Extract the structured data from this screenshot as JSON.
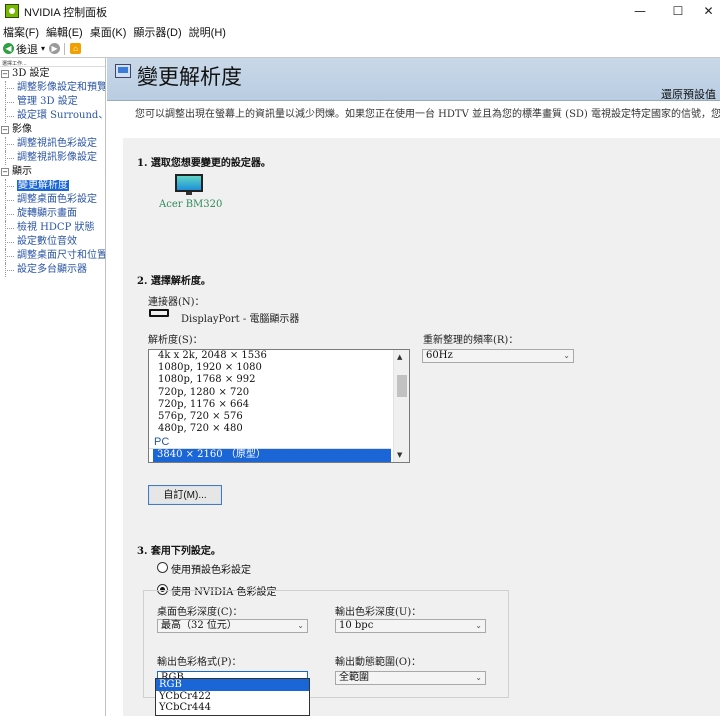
{
  "window": {
    "title": "NVIDIA 控制面板",
    "minimize_glyph": "—",
    "maximize_glyph": "☐",
    "close_glyph": "✕"
  },
  "menu": [
    "檔案(F)",
    "編輯(E)",
    "桌面(K)",
    "顯示器(D)",
    "說明(H)"
  ],
  "toolbar": {
    "back_label": "後退",
    "dropdown_glyph": "▾",
    "back_icon": "back-arrow-icon",
    "forward_icon": "forward-arrow-icon",
    "home_icon": "home-icon"
  },
  "sidebar": {
    "header": "選擇工作...",
    "categories": [
      {
        "label": "3D 設定",
        "toggle": "−",
        "items": [
          "調整影像設定和預覽",
          "管理 3D 設定",
          "設定環 Surround、PhysX"
        ]
      },
      {
        "label": "影像",
        "toggle": "−",
        "items": [
          "調整視訊色彩設定",
          "調整視訊影像設定"
        ]
      },
      {
        "label": "顯示",
        "toggle": "−",
        "items": [
          "變更解析度",
          "調整桌面色彩設定",
          "旋轉顯示畫面",
          "檢視 HDCP 狀態",
          "設定數位音效",
          "調整桌面尺寸和位置",
          "設定多台顯示器"
        ]
      }
    ],
    "selected_item": "變更解析度"
  },
  "page": {
    "title": "變更解析度",
    "restore_defaults": "還原預設值",
    "description": "您可以調整出現在螢幕上的資訊量以減少閃爍。如果您正在使用一台 HDTV 並且為您的標準畫質 (SD) 電視設定特定國家的信號，您也"
  },
  "section1": {
    "title": "1. 選取您想要變更的設定器。",
    "display_name": "Acer BM320"
  },
  "section2": {
    "title": "2. 選擇解析度。",
    "connector_label": "連接器(N)：",
    "connector_value": "DisplayPort - 電腦顯示器",
    "resolution_label": "解析度(S)：",
    "resolutions": [
      "4k x 2k, 2048 × 1536",
      "1080p, 1920 × 1080",
      "1080p, 1768 × 992",
      "720p, 1280 × 720",
      "720p, 1176 × 664",
      "576p, 720 × 576",
      "480p, 720 × 480"
    ],
    "pc_group": "PC",
    "selected_resolution": "3840 × 2160 （原型）",
    "refresh_label": "重新整理的頻率(R)：",
    "refresh_value": "60Hz",
    "custom_button": "自訂(M)...",
    "up_arrow": "▲",
    "down_arrow": "▼"
  },
  "section3": {
    "title": "3. 套用下列設定。",
    "radio_default": "使用預設色彩設定",
    "radio_nvidia": "使用 NVIDIA 色彩設定",
    "selected_radio": "nvidia",
    "desktop_depth_label": "桌面色彩深度(C)：",
    "desktop_depth_value": "最高（32 位元）",
    "output_depth_label": "輸出色彩深度(U)：",
    "output_depth_value": "10 bpc",
    "output_format_label": "輸出色彩格式(P)：",
    "output_format_value": "RGB",
    "output_range_label": "輸出動態範圍(O)：",
    "output_range_value": "全範圍",
    "format_options": [
      "RGB",
      "YCbCr422",
      "YCbCr444"
    ],
    "highlighted_option": "RGB"
  },
  "colors": {
    "selection": "#1a66d6",
    "link": "#2a55a5",
    "header_band": "#c9d8e8",
    "nvidia_green": "#76b900"
  }
}
